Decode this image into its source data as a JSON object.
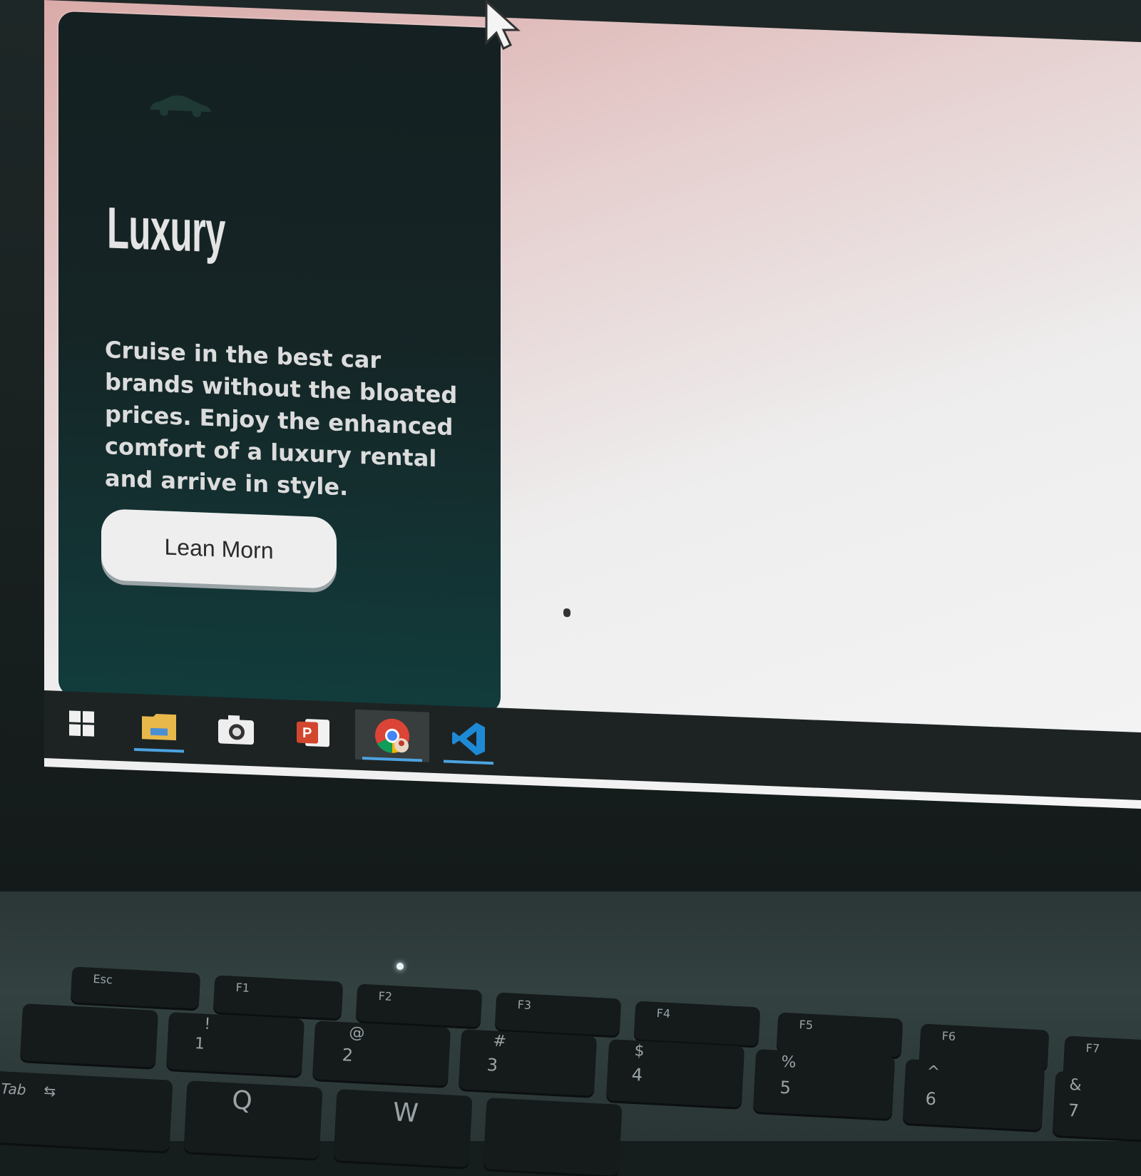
{
  "card": {
    "title": "Luxury",
    "description": "Cruise in the best car brands without the bloated prices. Enjoy the enhanced comfort of a luxury rental and arrive in style.",
    "button_label": "Lean Morn",
    "logo_icon": "car-icon"
  },
  "taskbar": {
    "items": [
      {
        "icon": "windows-start-icon",
        "active": false,
        "underline": false
      },
      {
        "icon": "file-explorer-icon",
        "active": false,
        "underline": true
      },
      {
        "icon": "camera-icon",
        "active": false,
        "underline": false
      },
      {
        "icon": "powerpoint-icon",
        "active": false,
        "underline": false
      },
      {
        "icon": "chrome-icon",
        "active": true,
        "underline": true
      },
      {
        "icon": "vscode-icon",
        "active": false,
        "underline": true
      }
    ]
  },
  "keyboard": {
    "function_row": [
      "Esc",
      "F1",
      "F2",
      "F3",
      "F4",
      "F5",
      "F6",
      "F7"
    ],
    "number_row": [
      {
        "top": "!",
        "bottom": "1"
      },
      {
        "top": "@",
        "bottom": "2"
      },
      {
        "top": "#",
        "bottom": "3"
      },
      {
        "top": "$",
        "bottom": "4"
      },
      {
        "top": "%",
        "bottom": "5"
      },
      {
        "top": "^",
        "bottom": "6"
      },
      {
        "top": "&",
        "bottom": "7"
      }
    ],
    "letter_row": [
      "Tab",
      "Q",
      "W"
    ]
  },
  "colors": {
    "card_top": "#142021",
    "card_bottom": "#123c3c",
    "screen_bg": "#eeeeee",
    "taskbar_accent": "#4ca3e0"
  }
}
